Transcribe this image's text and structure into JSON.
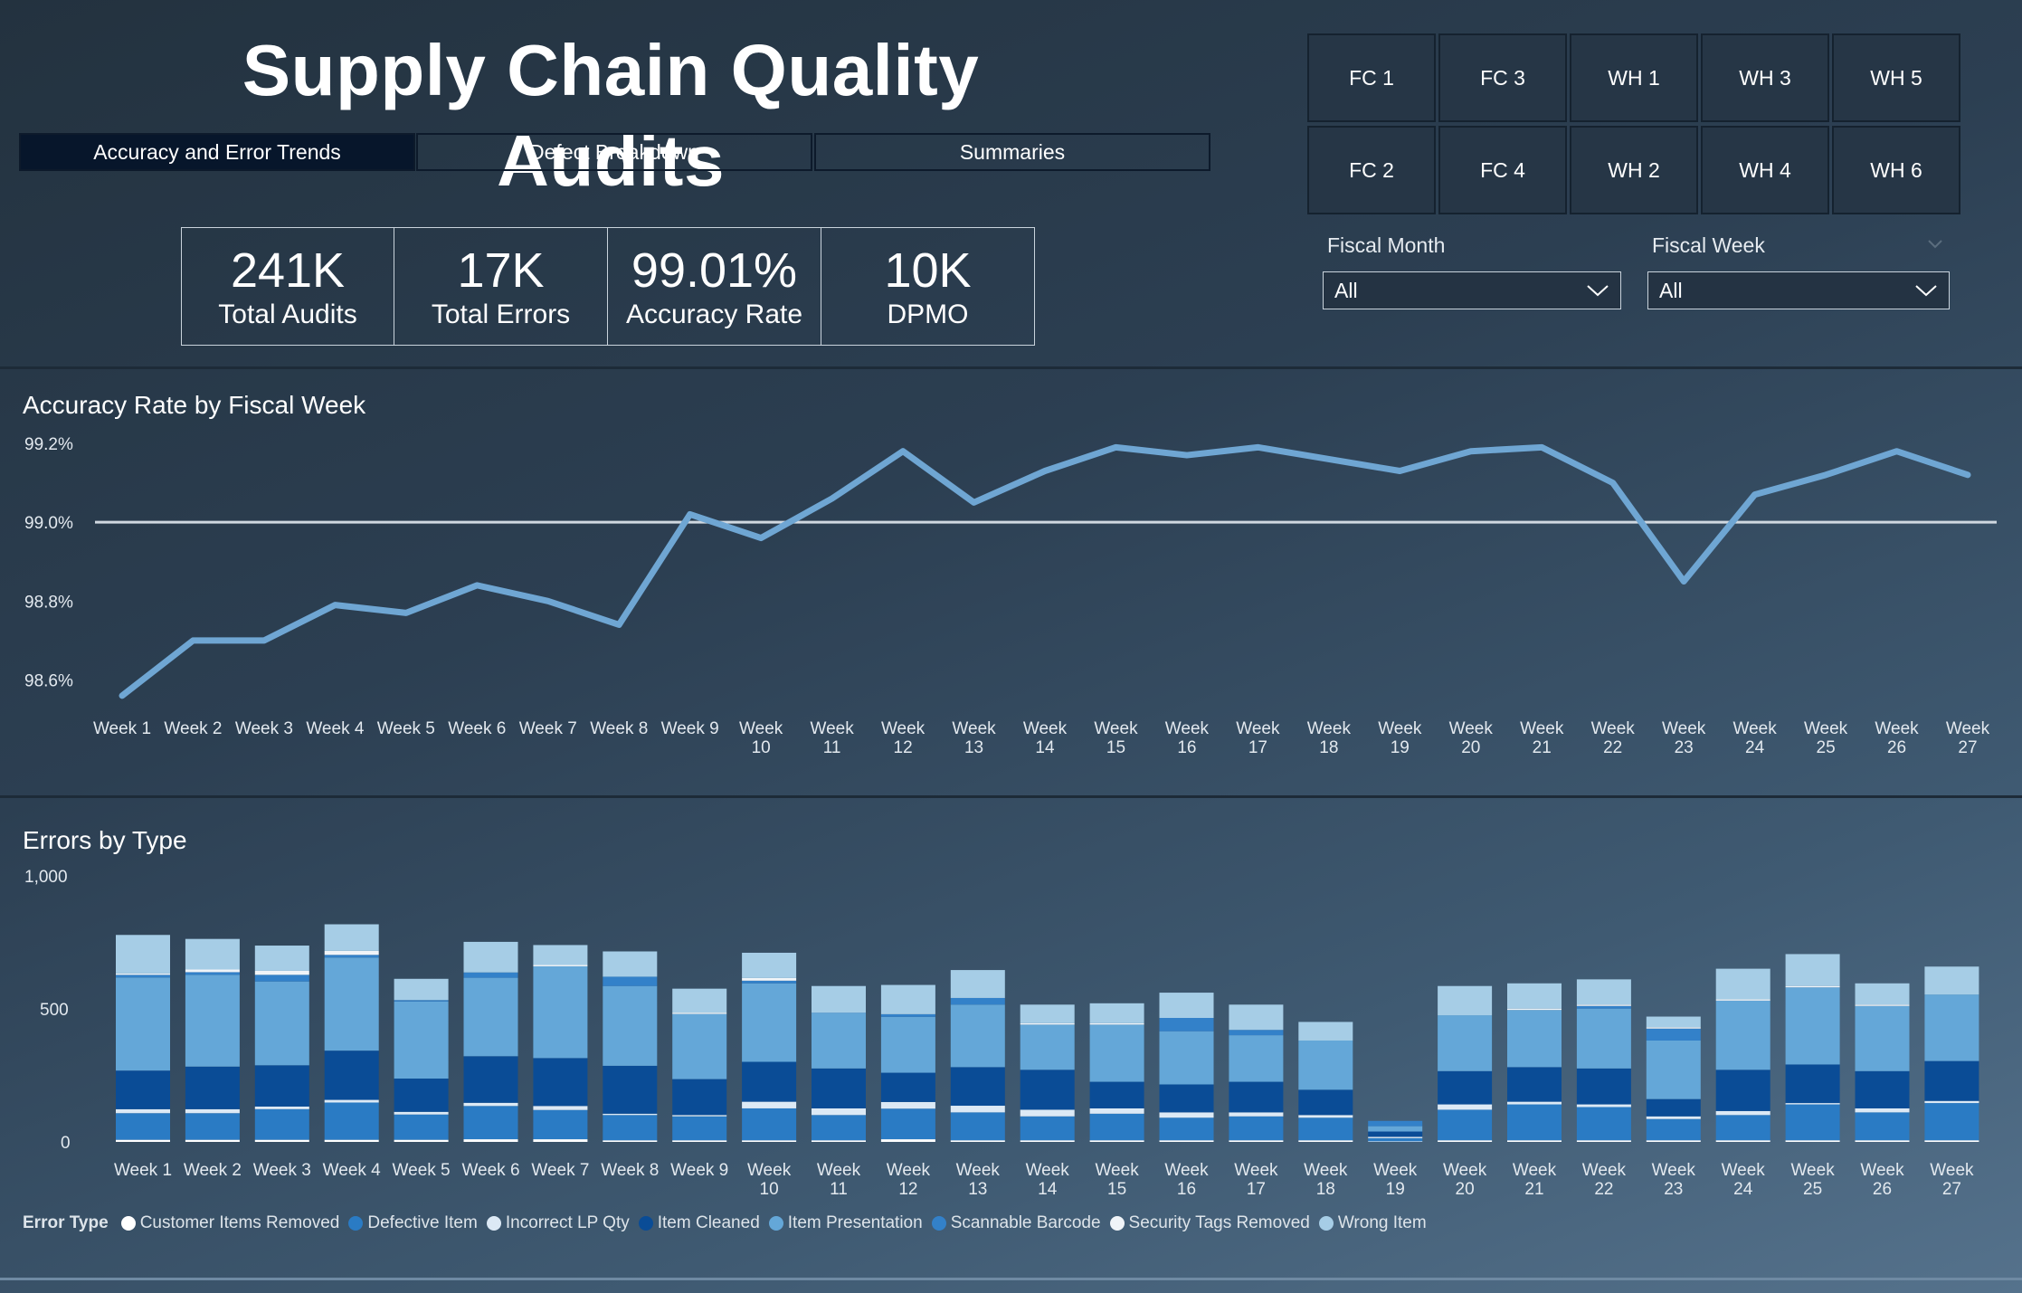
{
  "header": {
    "title": "Supply Chain Quality Audits"
  },
  "tabs": [
    {
      "label": "Accuracy and Error Trends",
      "active": true
    },
    {
      "label": "Defect Breakdown",
      "active": false
    },
    {
      "label": "Summaries",
      "active": false
    }
  ],
  "kpis": [
    {
      "value": "241K",
      "label": "Total Audits"
    },
    {
      "value": "17K",
      "label": "Total Errors"
    },
    {
      "value": "99.01%",
      "label": "Accuracy Rate"
    },
    {
      "value": "10K",
      "label": "DPMO"
    }
  ],
  "facilities": [
    "FC 1",
    "FC 3",
    "WH 1",
    "WH 3",
    "WH 5",
    "FC 2",
    "FC 4",
    "WH 2",
    "WH 4",
    "WH 6"
  ],
  "filters": {
    "month": {
      "label": "Fiscal Month",
      "value": "All"
    },
    "week": {
      "label": "Fiscal Week",
      "value": "All"
    }
  },
  "colors": {
    "line": "#6fa6d3",
    "reference_line": "#d0d8e0",
    "series": [
      "#ffffff",
      "#2a7bc4",
      "#dce9f5",
      "#0a4c96",
      "#64a7d8",
      "#3381c9",
      "#f0f4f8",
      "#a6cde6"
    ]
  },
  "chart_data": [
    {
      "type": "line",
      "title": "Accuracy Rate by Fiscal Week",
      "categories": [
        "Week 1",
        "Week 2",
        "Week 3",
        "Week 4",
        "Week 5",
        "Week 6",
        "Week 7",
        "Week 8",
        "Week 9",
        "Week 10",
        "Week 11",
        "Week 12",
        "Week 13",
        "Week 14",
        "Week 15",
        "Week 16",
        "Week 17",
        "Week 18",
        "Week 19",
        "Week 20",
        "Week 21",
        "Week 22",
        "Week 23",
        "Week 24",
        "Week 25",
        "Week 26",
        "Week 27"
      ],
      "values": [
        98.56,
        98.7,
        98.7,
        98.79,
        98.77,
        98.84,
        98.8,
        98.74,
        99.02,
        98.96,
        99.06,
        99.18,
        99.05,
        99.13,
        99.19,
        99.17,
        99.19,
        99.16,
        99.13,
        99.18,
        99.19,
        99.1,
        98.85,
        99.07,
        99.12,
        99.18,
        99.12
      ],
      "reference_line": 99.0,
      "ylim": [
        98.5,
        99.2
      ],
      "yticks": [
        "98.6%",
        "98.8%",
        "99.0%",
        "99.2%"
      ],
      "ytick_values": [
        98.6,
        98.8,
        99.0,
        99.2
      ],
      "grid": false
    },
    {
      "type": "bar",
      "stacked": true,
      "title": "Errors by Type",
      "categories": [
        "Week 1",
        "Week 2",
        "Week 3",
        "Week 4",
        "Week 5",
        "Week 6",
        "Week 7",
        "Week 8",
        "Week 9",
        "Week 10",
        "Week 11",
        "Week 12",
        "Week 13",
        "Week 14",
        "Week 15",
        "Week 16",
        "Week 17",
        "Week 18",
        "Week 19",
        "Week 20",
        "Week 21",
        "Week 22",
        "Week 23",
        "Week 24",
        "Week 25",
        "Week 26",
        "Week 27"
      ],
      "ylim": [
        0,
        1000
      ],
      "yticks": [
        "0",
        "500",
        "1,000"
      ],
      "ytick_values": [
        0,
        500,
        1000
      ],
      "legend_title": "Error Type",
      "legend_position": "bottom-left",
      "series": [
        {
          "name": "Customer Items Removed",
          "values": [
            8,
            8,
            8,
            8,
            8,
            10,
            10,
            6,
            6,
            6,
            6,
            10,
            6,
            6,
            6,
            6,
            6,
            6,
            2,
            6,
            6,
            6,
            6,
            6,
            6,
            6,
            6
          ]
        },
        {
          "name": "Defective Item",
          "values": [
            100,
            100,
            115,
            140,
            95,
            125,
            110,
            95,
            90,
            120,
            95,
            115,
            105,
            90,
            100,
            85,
            90,
            85,
            12,
            115,
            135,
            125,
            80,
            95,
            135,
            105,
            140
          ]
        },
        {
          "name": "Incorrect LP Qty",
          "values": [
            15,
            15,
            10,
            10,
            10,
            12,
            15,
            5,
            5,
            25,
            25,
            25,
            25,
            25,
            20,
            20,
            15,
            10,
            5,
            20,
            10,
            10,
            10,
            15,
            5,
            15,
            8
          ]
        },
        {
          "name": "Item Cleaned",
          "values": [
            145,
            160,
            155,
            185,
            125,
            175,
            180,
            180,
            135,
            150,
            150,
            110,
            145,
            150,
            100,
            105,
            115,
            95,
            20,
            125,
            130,
            135,
            65,
            155,
            145,
            140,
            150
          ]
        },
        {
          "name": "Item Presentation",
          "values": [
            350,
            345,
            315,
            350,
            290,
            295,
            345,
            300,
            245,
            295,
            210,
            210,
            235,
            170,
            215,
            200,
            175,
            185,
            20,
            210,
            215,
            225,
            220,
            260,
            290,
            245,
            250
          ]
        },
        {
          "name": "Scannable Barcode",
          "values": [
            10,
            10,
            25,
            10,
            5,
            20,
            0,
            35,
            0,
            10,
            0,
            10,
            25,
            0,
            0,
            50,
            20,
            0,
            20,
            0,
            0,
            10,
            45,
            0,
            0,
            0,
            0
          ]
        },
        {
          "name": "Security Tags Removed",
          "values": [
            5,
            10,
            15,
            15,
            0,
            0,
            5,
            0,
            5,
            10,
            0,
            0,
            0,
            5,
            5,
            0,
            0,
            0,
            0,
            0,
            5,
            5,
            5,
            5,
            5,
            5,
            0
          ]
        },
        {
          "name": "Wrong Item",
          "values": [
            145,
            115,
            95,
            100,
            80,
            115,
            75,
            95,
            90,
            95,
            100,
            110,
            105,
            70,
            75,
            95,
            95,
            70,
            0,
            110,
            95,
            95,
            40,
            115,
            120,
            80,
            105
          ]
        }
      ]
    }
  ]
}
